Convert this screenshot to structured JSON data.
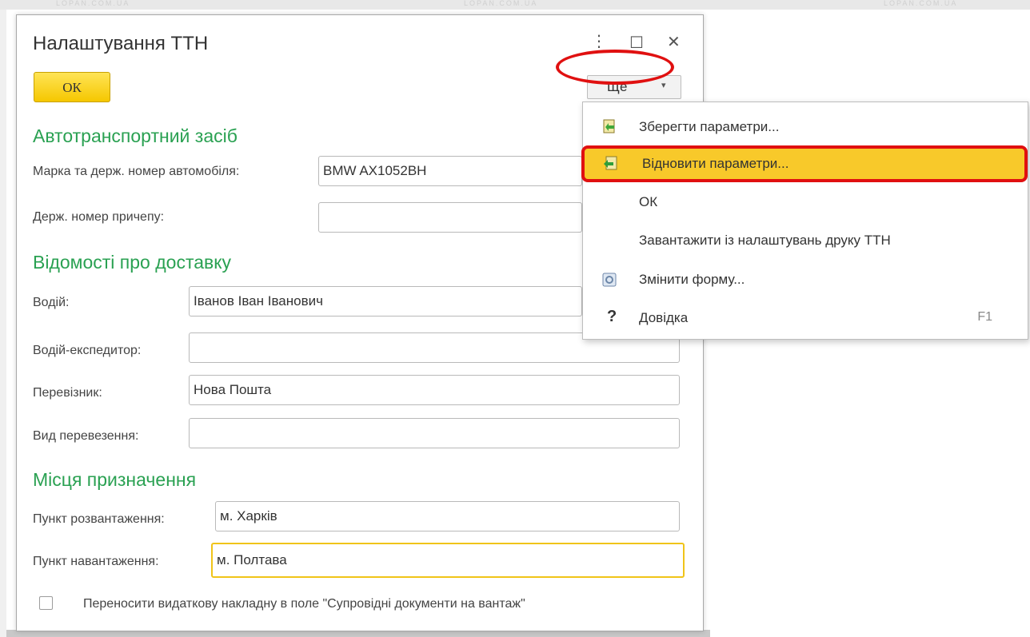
{
  "window": {
    "title": "Налаштування ТТН",
    "controls": {
      "menu_glyph": "⋮",
      "maximize_glyph": "☐",
      "close_glyph": "✕"
    }
  },
  "toolbar": {
    "ok_label": "ОК",
    "more_label": "Ще",
    "more_arrow": "▾"
  },
  "watermark": [
    "LOPAN.COM.UA",
    "LOPAN.COM.UA",
    "LOPAN.COM.UA"
  ],
  "sections": {
    "vehicle": {
      "title": "Автотранспортний засіб",
      "brand_label": "Марка та держ. номер автомобіля:",
      "brand_value": "BMW AX1052BH",
      "trailer_label": "Держ. номер причепу:",
      "trailer_value": ""
    },
    "delivery": {
      "title": "Відомості про доставку",
      "driver_label": "Водій:",
      "driver_value": "Іванов Іван Іванович",
      "forwarder_label": "Водій-експедитор:",
      "forwarder_value": "",
      "carrier_label": "Перевізник:",
      "carrier_value": "Нова Пошта",
      "transport_label": "Вид перевезення:",
      "transport_value": ""
    },
    "destination": {
      "title": "Місця призначення",
      "unload_label": "Пункт розвантаження:",
      "unload_value": "м. Харків",
      "load_label": "Пункт навантаження:",
      "load_value": "м. Полтава"
    }
  },
  "checkbox": {
    "label": "Переносити видаткову накладну в поле \"Супровідні документи на вантаж\"",
    "checked": false
  },
  "more_menu": {
    "items": [
      {
        "label": "Зберегти параметри...",
        "icon": "save-settings-icon"
      },
      {
        "label": "Відновити параметри...",
        "icon": "restore-settings-icon"
      },
      {
        "label": "ОК"
      },
      {
        "label": "Завантажити із налаштувань друку ТТН"
      },
      {
        "label": "Змінити форму...",
        "icon": "change-form-icon"
      },
      {
        "label": "Довідка",
        "icon": "help-icon",
        "icon_glyph": "?",
        "shortcut": "F1"
      }
    ]
  },
  "colors": {
    "section_title": "#2aa152",
    "ok_button": "#f5c700",
    "highlight": "#f8c92a",
    "annotation_red": "#e01010"
  }
}
